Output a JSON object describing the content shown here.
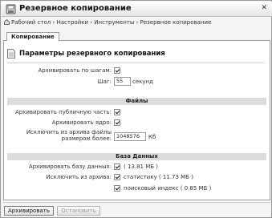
{
  "window": {
    "title": "Резервное копирование"
  },
  "breadcrumb": {
    "text": "Рабочий стол › Настройки › Инструменты › Резервное копирование"
  },
  "tab": {
    "label": "Копирование"
  },
  "panel": {
    "title": "Параметры резервного копирования"
  },
  "step": {
    "label": "Архивировать по шагам:",
    "checked": true,
    "step_label": "Шаг:",
    "step_value": "55",
    "step_unit": "секунд"
  },
  "files": {
    "header": "Файлы",
    "public_label": "Архивировать публичную часть:",
    "public_checked": true,
    "core_label": "Архивировать ядро:",
    "core_checked": true,
    "exclude_label_1": "Исключить из архива файлы",
    "exclude_label_2": "размером более:",
    "exclude_value": "1048576",
    "exclude_unit": "Кб"
  },
  "db": {
    "header": "База Данных",
    "archive_label": "Архивировать базу данных:",
    "archive_checked": true,
    "archive_size": "( 13.81 МБ )",
    "exclude_label": "Исключить из архива:",
    "stats_checked": true,
    "stats_text": "статистику ( 11.73 МБ )",
    "search_checked": true,
    "search_text": "поисковый индекс ( 0.85 МБ )"
  },
  "buttons": {
    "archive": "Архивировать",
    "stop": "Остановить"
  }
}
